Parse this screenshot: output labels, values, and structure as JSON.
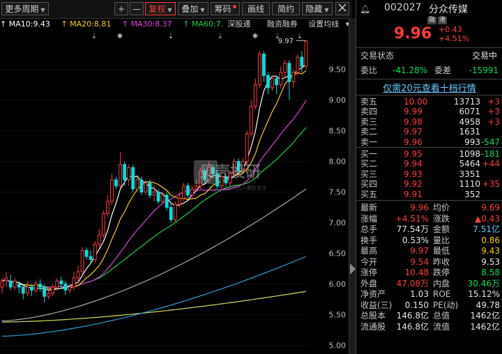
{
  "toolbar": {
    "period": "更多周期",
    "plus": "+",
    "minus": "—",
    "adjust": "复权",
    "overlay": "叠加",
    "chips": "筹码",
    "draw": "画线",
    "summary": "简约",
    "hide": "隐藏",
    "more_icon": "grid-icon"
  },
  "indicators": {
    "ma10": "MA10:9.43",
    "ma20": "MA20:8.81",
    "ma30": "MA30:8.37",
    "ma60": "MA60:7.",
    "sgt": "深股通",
    "margin": "融资融券",
    "settings": "设置均线"
  },
  "colors": {
    "up": "#ff3b3b",
    "down": "#00e0e0",
    "ma10": "#ffffff",
    "ma20": "#ffd000",
    "ma30": "#e040e0",
    "ma60": "#20d040",
    "ma120": "#aaaaaa",
    "ma250": "#2a9fd6",
    "ma_long": "#d8d860"
  },
  "chart_data": {
    "type": "candlestick",
    "y_ticks": [
      "9.50",
      "9.00",
      "8.50",
      "8.00",
      "7.50",
      "7.00",
      "6.50",
      "6.00",
      "5.50",
      "5.00"
    ],
    "ylim": [
      4.95,
      9.95
    ],
    "high_label": "9.97",
    "candles": [
      [
        5.95,
        6.05,
        5.85,
        6.1
      ],
      [
        6.05,
        6.1,
        5.95,
        6.2
      ],
      [
        6.05,
        5.95,
        5.9,
        6.15
      ],
      [
        5.95,
        6.05,
        5.9,
        6.1
      ],
      [
        6.0,
        5.95,
        5.85,
        6.05
      ],
      [
        5.95,
        5.85,
        5.75,
        6.0
      ],
      [
        5.85,
        5.95,
        5.8,
        6.05
      ],
      [
        5.95,
        5.9,
        5.8,
        6.0
      ],
      [
        5.9,
        6.0,
        5.85,
        6.05
      ],
      [
        6.0,
        5.95,
        5.88,
        6.08
      ],
      [
        5.95,
        5.8,
        5.7,
        6.0
      ],
      [
        5.8,
        5.85,
        5.75,
        5.95
      ],
      [
        5.85,
        5.95,
        5.8,
        6.0
      ],
      [
        5.95,
        6.05,
        5.9,
        6.1
      ],
      [
        6.05,
        6.0,
        5.92,
        6.12
      ],
      [
        6.0,
        5.9,
        5.82,
        6.05
      ],
      [
        5.9,
        5.95,
        5.85,
        6.0
      ],
      [
        5.95,
        6.1,
        5.9,
        6.2
      ],
      [
        6.1,
        6.2,
        6.0,
        6.3
      ],
      [
        6.2,
        6.55,
        6.15,
        6.6
      ],
      [
        6.55,
        6.45,
        6.4,
        6.6
      ],
      [
        6.45,
        6.4,
        6.35,
        6.55
      ],
      [
        6.4,
        6.65,
        6.35,
        6.7
      ],
      [
        6.65,
        6.8,
        6.6,
        6.9
      ],
      [
        6.8,
        7.15,
        6.75,
        7.2
      ],
      [
        7.15,
        7.35,
        7.1,
        7.45
      ],
      [
        7.35,
        7.7,
        7.3,
        7.8
      ],
      [
        7.7,
        7.6,
        7.55,
        7.75
      ],
      [
        7.6,
        7.95,
        7.55,
        8.15
      ],
      [
        7.95,
        7.7,
        7.6,
        8.0
      ],
      [
        7.7,
        7.9,
        7.6,
        7.95
      ],
      [
        7.9,
        7.55,
        7.5,
        7.95
      ],
      [
        7.55,
        7.7,
        7.5,
        7.75
      ],
      [
        7.7,
        7.5,
        7.45,
        7.75
      ],
      [
        7.5,
        7.65,
        7.45,
        7.7
      ],
      [
        7.65,
        7.45,
        7.4,
        7.7
      ],
      [
        7.45,
        7.5,
        7.35,
        7.6
      ],
      [
        7.5,
        7.35,
        7.3,
        7.55
      ],
      [
        7.35,
        7.45,
        7.3,
        7.5
      ],
      [
        7.45,
        7.25,
        7.2,
        7.5
      ],
      [
        7.25,
        7.05,
        7.0,
        7.3
      ],
      [
        7.05,
        7.3,
        7.0,
        7.35
      ],
      [
        7.3,
        7.4,
        7.25,
        7.5
      ],
      [
        7.4,
        7.6,
        7.35,
        7.65
      ],
      [
        7.6,
        7.45,
        7.4,
        7.65
      ],
      [
        7.45,
        7.55,
        7.4,
        7.6
      ],
      [
        7.55,
        7.6,
        7.5,
        7.7
      ],
      [
        7.6,
        7.85,
        7.55,
        7.9
      ],
      [
        7.85,
        7.7,
        7.65,
        7.9
      ],
      [
        7.7,
        7.9,
        7.65,
        8.0
      ],
      [
        7.9,
        7.8,
        7.75,
        7.95
      ],
      [
        7.8,
        7.6,
        7.55,
        7.85
      ],
      [
        7.6,
        7.75,
        7.55,
        7.8
      ],
      [
        7.75,
        7.65,
        7.6,
        7.8
      ],
      [
        7.65,
        7.8,
        7.6,
        7.85
      ],
      [
        7.8,
        8.0,
        7.75,
        8.05
      ],
      [
        8.0,
        7.85,
        7.8,
        8.05
      ],
      [
        7.85,
        8.0,
        7.8,
        8.05
      ],
      [
        8.0,
        8.45,
        7.95,
        8.5
      ],
      [
        8.45,
        8.9,
        8.4,
        9.0
      ],
      [
        8.9,
        9.25,
        8.85,
        9.35
      ],
      [
        9.25,
        9.75,
        9.2,
        9.8
      ],
      [
        9.75,
        9.4,
        9.3,
        9.8
      ],
      [
        9.4,
        9.2,
        9.1,
        9.45
      ],
      [
        9.2,
        9.35,
        9.15,
        9.4
      ],
      [
        9.35,
        9.25,
        9.1,
        9.4
      ],
      [
        9.25,
        9.45,
        9.2,
        9.55
      ],
      [
        9.45,
        9.6,
        9.35,
        9.65
      ],
      [
        9.6,
        9.3,
        9.0,
        9.65
      ],
      [
        9.3,
        9.45,
        9.2,
        9.5
      ],
      [
        9.45,
        9.7,
        9.4,
        9.75
      ],
      [
        9.7,
        9.55,
        9.45,
        9.8
      ],
      [
        9.55,
        9.96,
        9.5,
        9.97
      ]
    ]
  },
  "quote": {
    "code": "002027",
    "name": "分众传媒",
    "tag1": "融",
    "tag2": "港",
    "price": "9.96",
    "change": "+0.43",
    "change_pct": "+4.51%",
    "status_label": "交易状态",
    "status_value": "交易中",
    "ratio_label": "委比",
    "ratio_value": "-41.28%",
    "diff_label": "委差",
    "diff_value": "-15991",
    "promo": "仅需20元查看十档行情"
  },
  "orderbook": {
    "asks": [
      {
        "label": "卖五",
        "price": "10.00",
        "vol": "13713",
        "delta": "+3"
      },
      {
        "label": "卖四",
        "price": "9.99",
        "vol": "6071",
        "delta": "+3"
      },
      {
        "label": "卖三",
        "price": "9.98",
        "vol": "4958",
        "delta": "+3"
      },
      {
        "label": "卖二",
        "price": "9.97",
        "vol": "1631",
        "delta": ""
      },
      {
        "label": "卖一",
        "price": "9.96",
        "vol": "993",
        "delta": "-547"
      }
    ],
    "bids": [
      {
        "label": "买一",
        "price": "9.95",
        "vol": "1098",
        "delta": "-181"
      },
      {
        "label": "买二",
        "price": "9.94",
        "vol": "5464",
        "delta": "+44"
      },
      {
        "label": "买三",
        "price": "9.93",
        "vol": "3351",
        "delta": ""
      },
      {
        "label": "买四",
        "price": "9.92",
        "vol": "1110",
        "delta": "+35"
      },
      {
        "label": "买五",
        "price": "9.91",
        "vol": "352",
        "delta": ""
      }
    ]
  },
  "stats": [
    {
      "l1": "最新",
      "v1": "9.96",
      "c1": "r",
      "l2": "均价",
      "v2": "9.69",
      "c2": "r"
    },
    {
      "l1": "涨幅",
      "v1": "+4.51%",
      "c1": "r",
      "l2": "涨跌",
      "v2": "▲0.43",
      "c2": "r"
    },
    {
      "l1": "总手",
      "v1": "77.54万",
      "c1": "w",
      "l2": "金额",
      "v2": "7.51亿",
      "c2": "c"
    },
    {
      "l1": "换手",
      "v1": "0.53%",
      "c1": "w",
      "l2": "量比",
      "v2": "0.86",
      "c2": "y"
    },
    {
      "l1": "最高",
      "v1": "9.97",
      "c1": "r",
      "l2": "最低",
      "v2": "9.43",
      "c2": "y"
    },
    {
      "l1": "今开",
      "v1": "9.54",
      "c1": "r",
      "l2": "昨收",
      "v2": "9.53",
      "c2": "w"
    },
    {
      "l1": "涨停",
      "v1": "10.48",
      "c1": "r",
      "l2": "跌停",
      "v2": "8.58",
      "c2": "g"
    },
    {
      "l1": "外盘",
      "v1": "47.08万",
      "c1": "r",
      "l2": "内盘",
      "v2": "30.46万",
      "c2": "g"
    },
    {
      "l1": "净资产",
      "v1": "1.03",
      "c1": "w",
      "l2": "ROE",
      "v2": "15.12%",
      "c2": "w"
    },
    {
      "l1": "收益(三)",
      "v1": "0.150",
      "c1": "w",
      "l2": "PE(动)",
      "v2": "49.78",
      "c2": "w"
    },
    {
      "l1": "总股本",
      "v1": "146.8亿",
      "c1": "w",
      "l2": "总值",
      "v2": "1462亿",
      "c2": "w"
    },
    {
      "l1": "流通股",
      "v1": "146.8亿",
      "c1": "w",
      "l2": "流值",
      "v2": "1462亿",
      "c2": "w"
    }
  ],
  "watermark": {
    "main": "贝壳投研",
    "sub": "专注于值投资的人都在关注"
  }
}
